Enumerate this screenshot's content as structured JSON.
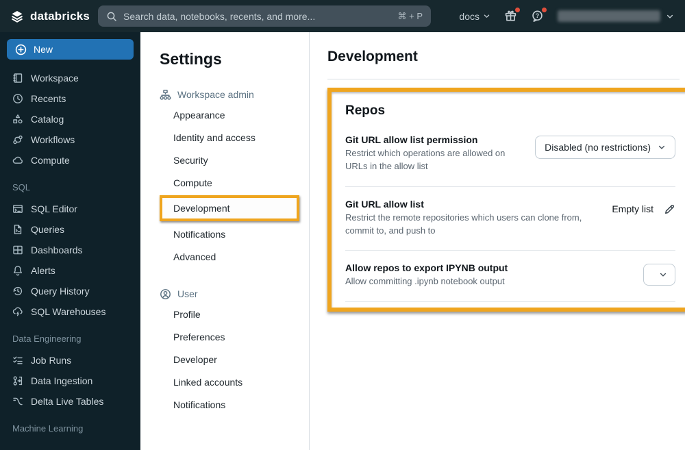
{
  "topbar": {
    "logo": "databricks",
    "search_placeholder": "Search data, notebooks, recents, and more...",
    "search_shortcut": "⌘ + P",
    "docs": "docs"
  },
  "colors": {
    "topbar_bg": "#17282E",
    "sidebar_bg": "#0F2129",
    "accent_blue": "#2272B4",
    "annotation_yellow": "#EFA51F",
    "notification_red": "#E04F3C"
  },
  "sidebar": {
    "new": "New",
    "main_items": [
      "Workspace",
      "Recents",
      "Catalog",
      "Workflows",
      "Compute"
    ],
    "sql_label": "SQL",
    "sql_items": [
      "SQL Editor",
      "Queries",
      "Dashboards",
      "Alerts",
      "Query History",
      "SQL Warehouses"
    ],
    "de_label": "Data Engineering",
    "de_items": [
      "Job Runs",
      "Data Ingestion",
      "Delta Live Tables"
    ],
    "ml_label": "Machine Learning"
  },
  "settings": {
    "title": "Settings",
    "admin_header": "Workspace admin",
    "admin_items": [
      "Appearance",
      "Identity and access",
      "Security",
      "Compute",
      "Development",
      "Notifications",
      "Advanced"
    ],
    "user_header": "User",
    "user_items": [
      "Profile",
      "Preferences",
      "Developer",
      "Linked accounts",
      "Notifications"
    ],
    "selected_item": "Development"
  },
  "main": {
    "title": "Development",
    "repos": {
      "heading": "Repos",
      "rows": [
        {
          "title": "Git URL allow list permission",
          "description": "Restrict which operations are allowed on URLs in the allow list",
          "value": "Disabled (no restrictions)"
        },
        {
          "title": "Git URL allow list",
          "description": "Restrict the remote repositories which users can clone from, commit to, and push to",
          "value": "Empty list"
        },
        {
          "title": "Allow repos to export IPYNB output",
          "description": "Allow committing .ipynb notebook output",
          "value": ""
        }
      ]
    }
  }
}
